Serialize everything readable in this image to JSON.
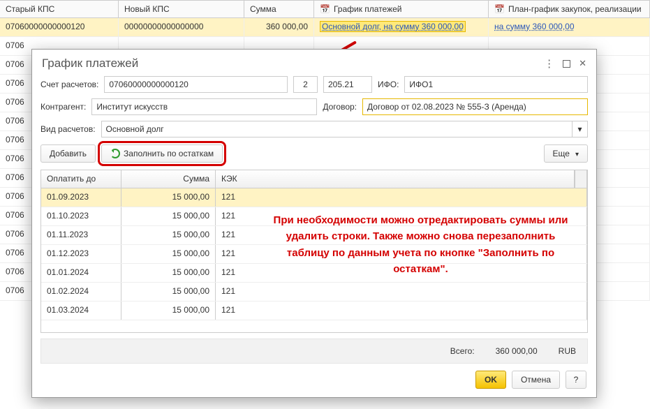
{
  "bg_headers": {
    "old_kps": "Старый КПС",
    "new_kps": "Новый КПС",
    "sum": "Сумма",
    "schedule": "График платежей",
    "plan": "План-график закупок, реализации"
  },
  "bg_row": {
    "old_kps": "07060000000000120",
    "new_kps": "00000000000000000",
    "sum": "360 000,00",
    "schedule": "Основной долг, на сумму 360 000,00",
    "plan": "на сумму 360 000,00"
  },
  "bg_stub": "0706",
  "dialog": {
    "title": "График платежей",
    "labels": {
      "account": "Счет расчетов:",
      "ifo": "ИФО:",
      "counterparty": "Контрагент:",
      "contract": "Договор:",
      "calc_type": "Вид расчетов:"
    },
    "fields": {
      "account": "07060000000000120",
      "sub1": "2",
      "sub2": "205.21",
      "ifo": "ИФО1",
      "counterparty": "Институт искусств",
      "contract": "Договор от 02.08.2023 № 555-З (Аренда)",
      "calc_type": "Основной долг"
    },
    "toolbar": {
      "add": "Добавить",
      "fill": "Заполнить по остаткам",
      "more": "Еще"
    },
    "table": {
      "headers": {
        "paydate": "Оплатить до",
        "sum": "Сумма",
        "kek": "КЭК"
      },
      "rows": [
        {
          "date": "01.09.2023",
          "sum": "15 000,00",
          "kek": "121",
          "hl": true
        },
        {
          "date": "01.10.2023",
          "sum": "15 000,00",
          "kek": "121"
        },
        {
          "date": "01.11.2023",
          "sum": "15 000,00",
          "kek": "121"
        },
        {
          "date": "01.12.2023",
          "sum": "15 000,00",
          "kek": "121"
        },
        {
          "date": "01.01.2024",
          "sum": "15 000,00",
          "kek": "121"
        },
        {
          "date": "01.02.2024",
          "sum": "15 000,00",
          "kek": "121"
        },
        {
          "date": "01.03.2024",
          "sum": "15 000,00",
          "kek": "121"
        }
      ]
    },
    "totals": {
      "label": "Всего:",
      "sum": "360 000,00",
      "cur": "RUB"
    },
    "buttons": {
      "ok": "OK",
      "cancel": "Отмена",
      "help": "?"
    }
  },
  "note": "При необходимости можно отредактировать суммы или удалить строки. Также можно снова перезаполнить таблицу по данным учета по кнопке \"Заполнить по остаткам\"."
}
